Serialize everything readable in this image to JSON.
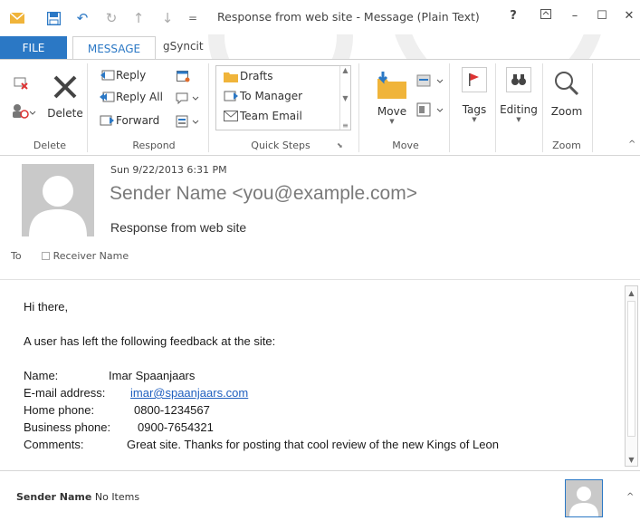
{
  "window": {
    "title": "Response from web site - Message (Plain Text)",
    "help": "?",
    "min": "–",
    "max": "☐",
    "close": "✕"
  },
  "quick_access": {
    "customize": "="
  },
  "tabs": [
    {
      "label": "FILE"
    },
    {
      "label": "MESSAGE"
    },
    {
      "label": "gSyncit"
    }
  ],
  "ribbon": {
    "delete_group": {
      "delete_label": "Delete",
      "group_label": "Delete"
    },
    "respond_group": {
      "reply": "Reply",
      "reply_all": "Reply All",
      "forward": "Forward",
      "group_label": "Respond"
    },
    "quick_steps": {
      "items": [
        "Drafts",
        "To Manager",
        "Team Email"
      ],
      "group_label": "Quick Steps"
    },
    "move_group": {
      "move": "Move",
      "group_label": "Move"
    },
    "tags": {
      "label": "Tags"
    },
    "editing": {
      "label": "Editing"
    },
    "zoom_group": {
      "zoom": "Zoom",
      "group_label": "Zoom"
    }
  },
  "message": {
    "sent": "Sun 9/22/2013 6:31 PM",
    "sender": "Sender Name <you@example.com>",
    "subject": "Response from web site",
    "to_label": "To",
    "to_name": "Receiver Name"
  },
  "body": {
    "greeting": "Hi there,",
    "intro": "A user has left the following feedback at the site:",
    "name_label": "Name:",
    "name_value": "Imar Spaanjaars",
    "email_label": "E-mail address:",
    "email_value": "imar@spaanjaars.com",
    "home_label": "Home phone:",
    "home_value": "0800-1234567",
    "business_label": "Business phone:",
    "business_value": "0900-7654321",
    "comments_label": "Comments:",
    "comments_value": "Great site. Thanks for posting that cool review of the new Kings of Leon"
  },
  "people_pane": {
    "name": "Sender Name",
    "status": "No Items"
  },
  "colors": {
    "accent": "#2b78c5",
    "link": "#1f5fbf",
    "sender_text": "#7a7a7a"
  }
}
